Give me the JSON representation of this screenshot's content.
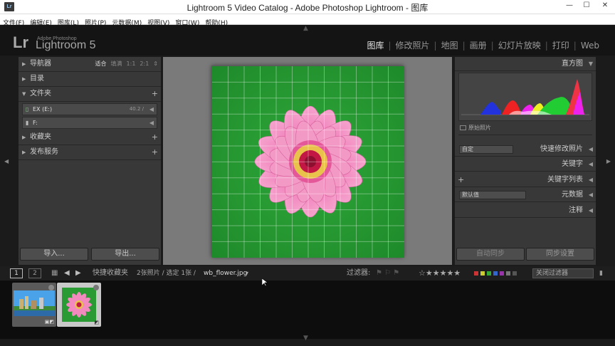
{
  "window": {
    "title": "Lightroom 5 Video Catalog - Adobe Photoshop Lightroom - 图库",
    "app_icon": "Lr",
    "controls": {
      "minimize": "—",
      "maximize": "☐",
      "close": "✕"
    }
  },
  "menu": [
    "文件(F)",
    "编辑(E)",
    "图库(L)",
    "照片(P)",
    "元数据(M)",
    "视图(V)",
    "窗口(W)",
    "帮助(H)"
  ],
  "identity": {
    "lr": "Lr",
    "adobe": "Adobe Photoshop",
    "product": "Lightroom 5"
  },
  "modules": {
    "items": [
      "图库",
      "修改照片",
      "地图",
      "画册",
      "幻灯片放映",
      "打印",
      "Web"
    ],
    "active": "图库",
    "separator": "|"
  },
  "left_panel": {
    "navigator": {
      "label": "导航器",
      "modes": [
        "适合",
        "填满",
        "1:1",
        "2:1"
      ],
      "active_mode": "适合"
    },
    "catalog": {
      "label": "目录"
    },
    "folders": {
      "label": "文件夹",
      "rows": [
        {
          "drive": "▯",
          "name": "EX (E:)",
          "count": "40.2 /",
          "go": "◀"
        },
        {
          "drive": "▮",
          "name": "F:",
          "count": "",
          "go": "◀"
        }
      ]
    },
    "collections": {
      "label": "收藏夹"
    },
    "publish": {
      "label": "发布服务"
    },
    "buttons": {
      "import": "导入...",
      "export": "导出..."
    }
  },
  "right_panel": {
    "histogram": {
      "label": "直方图"
    },
    "original_photo": {
      "label": "原始照片"
    },
    "quick_develop": {
      "preset": "自定",
      "label": "快速修改照片"
    },
    "keywording": {
      "label": "关键字"
    },
    "keyword_list": {
      "label": "关键字列表"
    },
    "metadata": {
      "preset": "默认值",
      "label": "元数据"
    },
    "comments": {
      "label": "注释"
    },
    "buttons": {
      "auto_sync": "自动同步",
      "sync_settings": "同步设置"
    }
  },
  "filmstrip_bar": {
    "pages": [
      "1",
      "2"
    ],
    "source": "快捷收藏夹",
    "selection_info": "2张照片 / 选定 1张 /",
    "filename": "wb_flower.jpg",
    "filter_label": "过滤器:",
    "filter_off": "关闭过滤器",
    "label_colors": [
      "#cc3333",
      "#cccc33",
      "#33aa33",
      "#3366cc",
      "#9933aa",
      "#777777",
      "#555555"
    ]
  },
  "filmstrip": {
    "thumbnails": [
      {
        "name": "city-skyline-thumbnail",
        "selected": false
      },
      {
        "name": "flower-thumbnail",
        "selected": true
      }
    ]
  },
  "colors": {
    "accent": "#e8e8e8",
    "panel": "#383838",
    "background": "#1b1b1b"
  }
}
